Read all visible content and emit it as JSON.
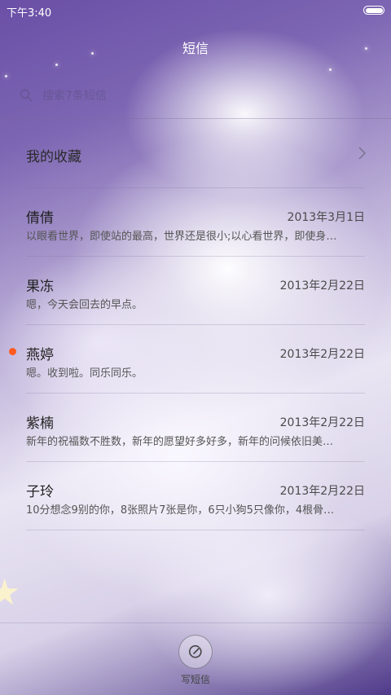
{
  "status_bar": {
    "time": "下午3:40"
  },
  "header": {
    "title": "短信"
  },
  "search": {
    "placeholder": "搜索7条短信"
  },
  "favorites": {
    "label": "我的收藏"
  },
  "conversations": [
    {
      "name": "倩倩",
      "date": "2013年3月1日",
      "preview": "以眼看世界，即使站的最高，世界还是很小;以心看世界，即使身…",
      "unread": false
    },
    {
      "name": "果冻",
      "date": "2013年2月22日",
      "preview": "嗯，今天会回去的早点。",
      "unread": false
    },
    {
      "name": "燕婷",
      "date": "2013年2月22日",
      "preview": "嗯。收到啦。同乐同乐。",
      "unread": true
    },
    {
      "name": "紫楠",
      "date": "2013年2月22日",
      "preview": "新年的祝福数不胜数，新年的愿望好多好多，新年的问候依旧美…",
      "unread": false
    },
    {
      "name": "子玲",
      "date": "2013年2月22日",
      "preview": "10分想念9别的你，8张照片7张是你，6只小狗5只像你，4根骨…",
      "unread": false
    }
  ],
  "compose": {
    "label": "写短信"
  },
  "colors": {
    "unread_dot": "#ff5a1f",
    "background_purple": "#6a4fa6"
  },
  "icons": {
    "search": "search-icon",
    "chevron": "chevron-right-icon",
    "compose": "compose-icon",
    "battery": "battery-icon"
  }
}
